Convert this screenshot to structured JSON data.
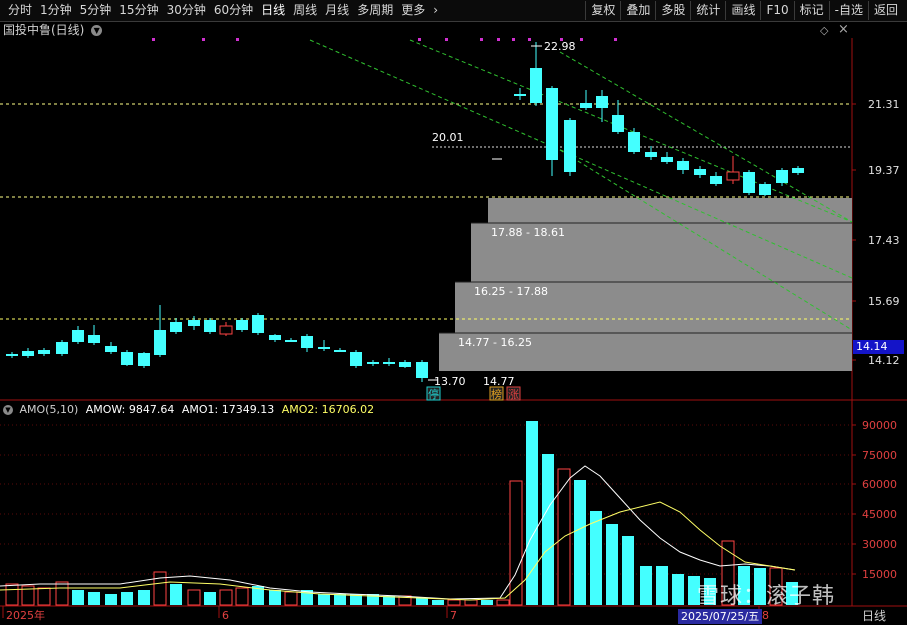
{
  "toolbar": {
    "periods": [
      "分时",
      "1分钟",
      "5分钟",
      "15分钟",
      "30分钟",
      "60分钟",
      "日线",
      "周线",
      "月线",
      "多周期",
      "更多"
    ],
    "active_period": "日线",
    "actions": [
      "复权",
      "叠加",
      "多股",
      "统计",
      "画线",
      "F10",
      "标记",
      "-自选",
      "返回"
    ]
  },
  "chart": {
    "stock_title": "国投中鲁(日线)",
    "price_axis": [
      "21.31",
      "19.37",
      "17.43",
      "15.69",
      "14.12"
    ],
    "current_price_tag": "14.14",
    "high_label": "22.98",
    "mid_label": "20.01",
    "low_label": "13.70",
    "low_label2": "14.77",
    "zones": [
      "17.88 - 18.61",
      "16.25 - 17.88",
      "14.77 - 16.25"
    ],
    "badges": [
      {
        "text": "停",
        "color": "#20d0d0"
      },
      {
        "text": "榜",
        "color": "#e0a020"
      },
      {
        "text": "涨",
        "color": "#e04040"
      }
    ]
  },
  "indicator": {
    "label": "AMO(5,10)",
    "amow": "AMOW: 9847.64",
    "amo1": "AMO1: 17349.13",
    "amo2": "AMO2: 16706.02",
    "axis": [
      "90000",
      "75000",
      "60000",
      "45000",
      "30000",
      "15000"
    ]
  },
  "x_axis": {
    "labels": [
      "2025年",
      "6",
      "7",
      "8"
    ],
    "cursor_date": "2025/07/25/五",
    "period_label": "日线"
  },
  "watermark": "雪球：滚子韩",
  "colors": {
    "up": "#ff4444",
    "down": "#44ffff",
    "ma_white": "#ffffff",
    "ma_yellow": "#ffff66",
    "zone": "#8a8a8a"
  }
}
